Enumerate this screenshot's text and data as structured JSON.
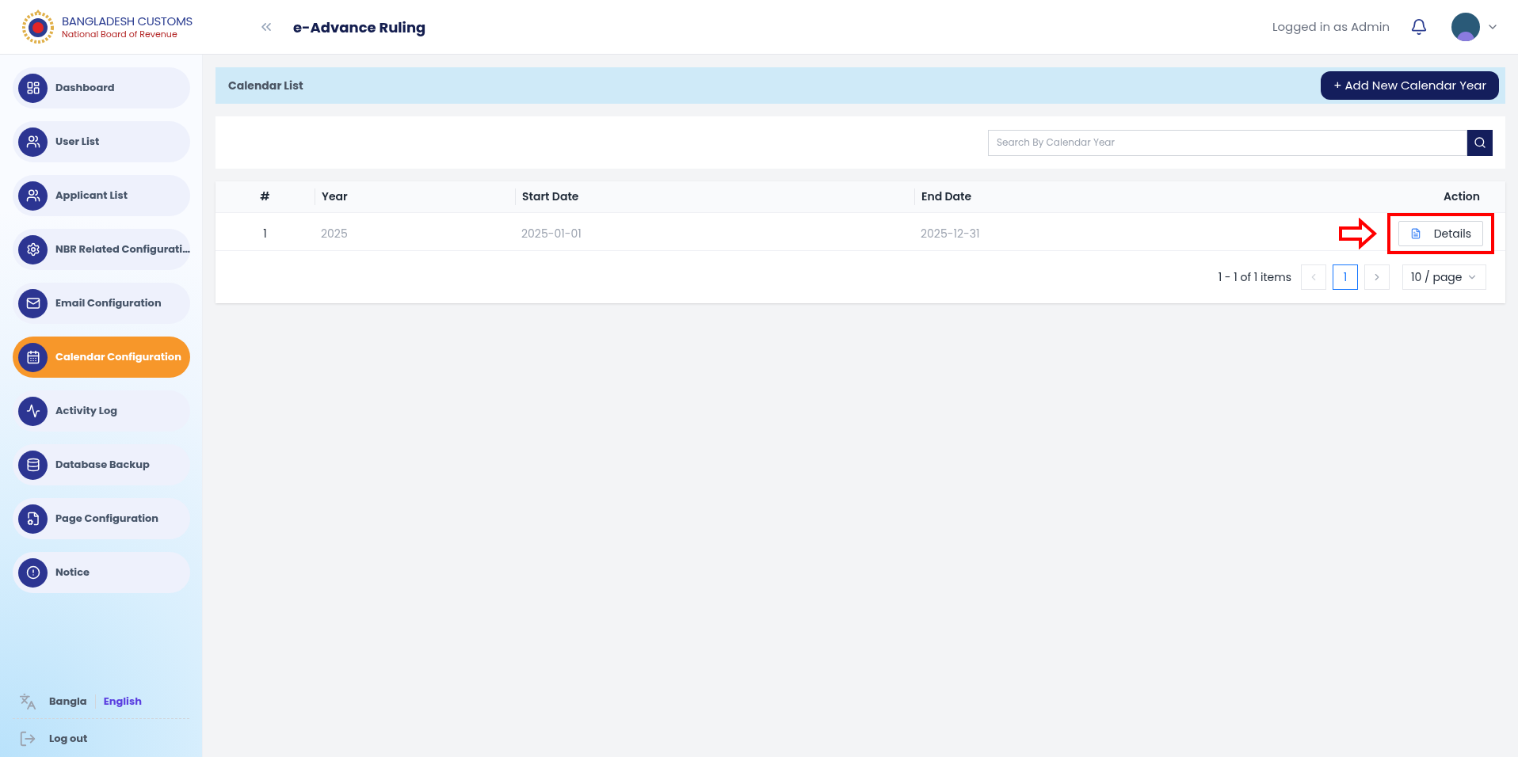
{
  "header": {
    "brand_title": "BANGLADESH CUSTOMS",
    "brand_subtitle": "National Board of Revenue",
    "app_title": "e-Advance Ruling",
    "user_label": "Logged in as Admin"
  },
  "sidebar": {
    "items": [
      {
        "label": "Dashboard",
        "selected": false
      },
      {
        "label": "User List",
        "selected": false
      },
      {
        "label": "Applicant List",
        "selected": false
      },
      {
        "label": "NBR Related Configurati…",
        "selected": false
      },
      {
        "label": "Email Configuration",
        "selected": false
      },
      {
        "label": "Calendar Configuration",
        "selected": true
      },
      {
        "label": "Activity Log",
        "selected": false
      },
      {
        "label": "Database Backup",
        "selected": false
      },
      {
        "label": "Page Configuration",
        "selected": false
      },
      {
        "label": "Notice",
        "selected": false
      }
    ],
    "languages": [
      {
        "label": "Bangla",
        "selected": false
      },
      {
        "label": "English",
        "selected": true
      }
    ],
    "logout": "Log out"
  },
  "page_header": {
    "title": "Calendar List",
    "add_button": "+ Add New Calendar Year"
  },
  "search": {
    "placeholder": "Search By Calendar Year"
  },
  "table": {
    "columns": [
      "#",
      "Year",
      "Start Date",
      "End Date",
      "Action"
    ],
    "rows": [
      {
        "index": "1",
        "year": "2025",
        "start_date": "2025-01-01",
        "end_date": "2025-12-31",
        "action": "Details"
      }
    ]
  },
  "pagination": {
    "summary": "1 - 1 of 1 items",
    "pages": [
      {
        "label": "1",
        "selected": true
      }
    ],
    "page_size": "10 / page"
  }
}
